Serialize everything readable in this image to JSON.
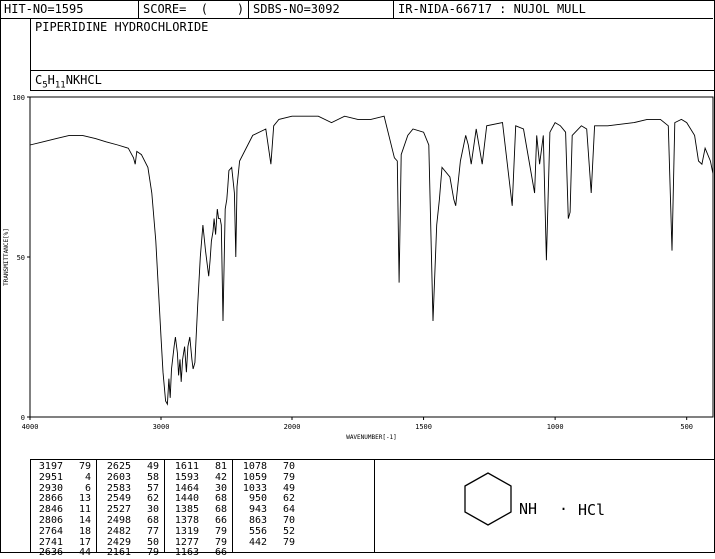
{
  "header": {
    "hit_no": "HIT-NO=1595",
    "score": "SCORE=  (    )",
    "sdbs_no": "SDBS-NO=3092",
    "ir_id": "IR-NIDA-66717 : NUJOL MULL"
  },
  "compound": {
    "name": "PIPERIDINE HYDROCHLORIDE",
    "formula_parts": [
      "C",
      "5",
      "H",
      "11",
      "NKHCL"
    ]
  },
  "chart_data": {
    "type": "line",
    "xlabel": "WAVENUMBER[-1]",
    "ylabel": "TRANSMITTANCE[%]",
    "xlim": [
      4000,
      400
    ],
    "ylim": [
      0,
      100
    ],
    "x_ticks": [
      4000,
      3000,
      2000,
      1500,
      1000,
      500
    ],
    "y_ticks": [
      0,
      50,
      100
    ],
    "series": [
      {
        "points": [
          [
            4000,
            85
          ],
          [
            3900,
            86
          ],
          [
            3800,
            87
          ],
          [
            3700,
            88
          ],
          [
            3600,
            88
          ],
          [
            3500,
            87
          ],
          [
            3420,
            86
          ],
          [
            3330,
            85
          ],
          [
            3250,
            84
          ],
          [
            3210,
            81
          ],
          [
            3197,
            79
          ],
          [
            3185,
            83
          ],
          [
            3150,
            82
          ],
          [
            3100,
            78
          ],
          [
            3070,
            70
          ],
          [
            3040,
            55
          ],
          [
            3020,
            40
          ],
          [
            3000,
            25
          ],
          [
            2985,
            14
          ],
          [
            2965,
            5
          ],
          [
            2951,
            4
          ],
          [
            2940,
            12
          ],
          [
            2930,
            6
          ],
          [
            2920,
            15
          ],
          [
            2900,
            22
          ],
          [
            2890,
            25
          ],
          [
            2875,
            20
          ],
          [
            2866,
            13
          ],
          [
            2855,
            18
          ],
          [
            2846,
            11
          ],
          [
            2835,
            18
          ],
          [
            2820,
            22
          ],
          [
            2806,
            14
          ],
          [
            2795,
            22
          ],
          [
            2780,
            25
          ],
          [
            2764,
            18
          ],
          [
            2755,
            15
          ],
          [
            2741,
            17
          ],
          [
            2720,
            35
          ],
          [
            2700,
            50
          ],
          [
            2680,
            60
          ],
          [
            2660,
            52
          ],
          [
            2636,
            44
          ],
          [
            2625,
            49
          ],
          [
            2615,
            55
          ],
          [
            2603,
            58
          ],
          [
            2595,
            62
          ],
          [
            2583,
            57
          ],
          [
            2570,
            65
          ],
          [
            2560,
            62
          ],
          [
            2549,
            62
          ],
          [
            2540,
            60
          ],
          [
            2527,
            30
          ],
          [
            2510,
            65
          ],
          [
            2498,
            68
          ],
          [
            2490,
            72
          ],
          [
            2482,
            77
          ],
          [
            2460,
            78
          ],
          [
            2440,
            70
          ],
          [
            2429,
            50
          ],
          [
            2420,
            72
          ],
          [
            2400,
            80
          ],
          [
            2300,
            88
          ],
          [
            2200,
            90
          ],
          [
            2161,
            79
          ],
          [
            2140,
            91
          ],
          [
            2100,
            93
          ],
          [
            2000,
            94
          ],
          [
            1950,
            94
          ],
          [
            1900,
            94
          ],
          [
            1850,
            92
          ],
          [
            1800,
            94
          ],
          [
            1750,
            93
          ],
          [
            1700,
            93
          ],
          [
            1650,
            94
          ],
          [
            1611,
            81
          ],
          [
            1600,
            80
          ],
          [
            1593,
            42
          ],
          [
            1585,
            82
          ],
          [
            1560,
            88
          ],
          [
            1540,
            90
          ],
          [
            1500,
            89
          ],
          [
            1480,
            85
          ],
          [
            1464,
            30
          ],
          [
            1450,
            60
          ],
          [
            1440,
            68
          ],
          [
            1430,
            78
          ],
          [
            1400,
            75
          ],
          [
            1385,
            68
          ],
          [
            1378,
            66
          ],
          [
            1360,
            80
          ],
          [
            1340,
            88
          ],
          [
            1330,
            85
          ],
          [
            1319,
            79
          ],
          [
            1300,
            90
          ],
          [
            1277,
            79
          ],
          [
            1260,
            91
          ],
          [
            1200,
            92
          ],
          [
            1163,
            66
          ],
          [
            1150,
            91
          ],
          [
            1120,
            90
          ],
          [
            1078,
            70
          ],
          [
            1070,
            88
          ],
          [
            1059,
            79
          ],
          [
            1045,
            88
          ],
          [
            1033,
            49
          ],
          [
            1020,
            89
          ],
          [
            1000,
            92
          ],
          [
            980,
            91
          ],
          [
            960,
            89
          ],
          [
            950,
            62
          ],
          [
            943,
            64
          ],
          [
            935,
            88
          ],
          [
            900,
            91
          ],
          [
            880,
            90
          ],
          [
            863,
            70
          ],
          [
            850,
            91
          ],
          [
            800,
            91
          ],
          [
            700,
            92
          ],
          [
            650,
            93
          ],
          [
            600,
            93
          ],
          [
            570,
            91
          ],
          [
            556,
            52
          ],
          [
            545,
            92
          ],
          [
            520,
            93
          ],
          [
            500,
            92
          ],
          [
            470,
            88
          ],
          [
            455,
            80
          ],
          [
            442,
            79
          ],
          [
            430,
            84
          ],
          [
            410,
            80
          ],
          [
            400,
            76
          ]
        ]
      }
    ]
  },
  "peaks": [
    {
      "wn": "3197",
      "t": "79"
    },
    {
      "wn": "2951",
      "t": "4"
    },
    {
      "wn": "2930",
      "t": "6"
    },
    {
      "wn": "2866",
      "t": "13"
    },
    {
      "wn": "2846",
      "t": "11"
    },
    {
      "wn": "2806",
      "t": "14"
    },
    {
      "wn": "2764",
      "t": "18"
    },
    {
      "wn": "2741",
      "t": "17"
    },
    {
      "wn": "2636",
      "t": "44"
    },
    {
      "wn": "2625",
      "t": "49"
    },
    {
      "wn": "2603",
      "t": "58"
    },
    {
      "wn": "2583",
      "t": "57"
    },
    {
      "wn": "2549",
      "t": "62"
    },
    {
      "wn": "2527",
      "t": "30"
    },
    {
      "wn": "2498",
      "t": "68"
    },
    {
      "wn": "2482",
      "t": "77"
    },
    {
      "wn": "2429",
      "t": "50"
    },
    {
      "wn": "2161",
      "t": "79"
    },
    {
      "wn": "1611",
      "t": "81"
    },
    {
      "wn": "1593",
      "t": "42"
    },
    {
      "wn": "1464",
      "t": "30"
    },
    {
      "wn": "1440",
      "t": "68"
    },
    {
      "wn": "1385",
      "t": "68"
    },
    {
      "wn": "1378",
      "t": "66"
    },
    {
      "wn": "1319",
      "t": "79"
    },
    {
      "wn": "1277",
      "t": "79"
    },
    {
      "wn": "1163",
      "t": "66"
    },
    {
      "wn": "1078",
      "t": "70"
    },
    {
      "wn": "1059",
      "t": "79"
    },
    {
      "wn": "1033",
      "t": "49"
    },
    {
      "wn": "950",
      "t": "62"
    },
    {
      "wn": "943",
      "t": "64"
    },
    {
      "wn": "863",
      "t": "70"
    },
    {
      "wn": "556",
      "t": "52"
    },
    {
      "wn": "442",
      "t": "79"
    }
  ],
  "structure": {
    "nh_label": "NH",
    "dot": "·",
    "salt_label": "HCl"
  }
}
